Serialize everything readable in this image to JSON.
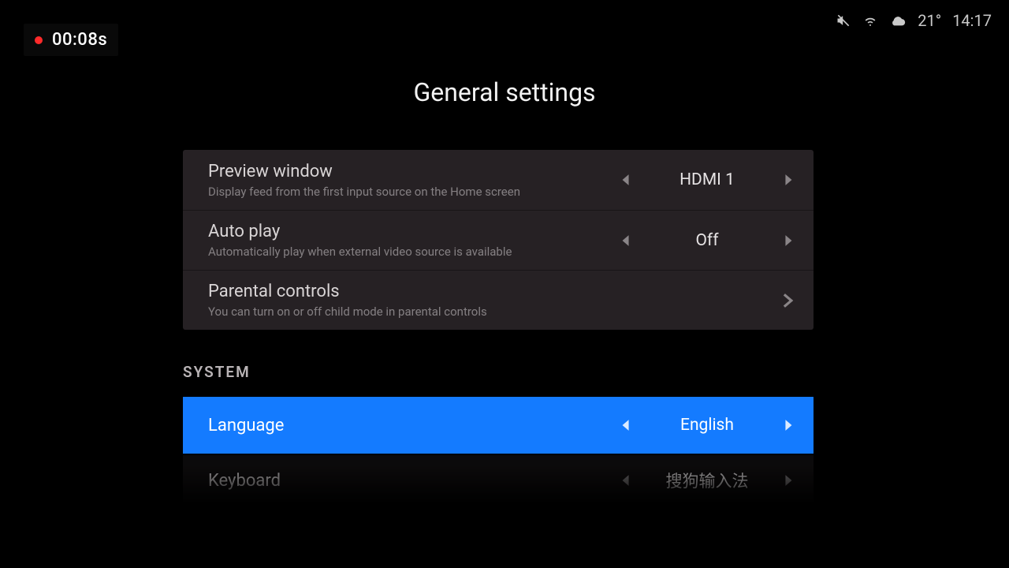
{
  "recording": {
    "time": "00:08s"
  },
  "status": {
    "temp": "21°",
    "clock": "14:17"
  },
  "header": {
    "title": "General settings"
  },
  "group1": {
    "items": [
      {
        "title": "Preview window",
        "subtitle": "Display feed from the first input source on the Home screen",
        "value": "HDMI 1"
      },
      {
        "title": "Auto play",
        "subtitle": "Automatically play when external video source is available",
        "value": "Off"
      },
      {
        "title": "Parental controls",
        "subtitle": "You can turn on or off child mode in parental controls"
      }
    ]
  },
  "section_system": "SYSTEM",
  "system": {
    "items": [
      {
        "title": "Language",
        "value": "English"
      },
      {
        "title": "Keyboard",
        "value": "搜狗输入法"
      }
    ]
  },
  "colors": {
    "accent": "#147bff"
  }
}
